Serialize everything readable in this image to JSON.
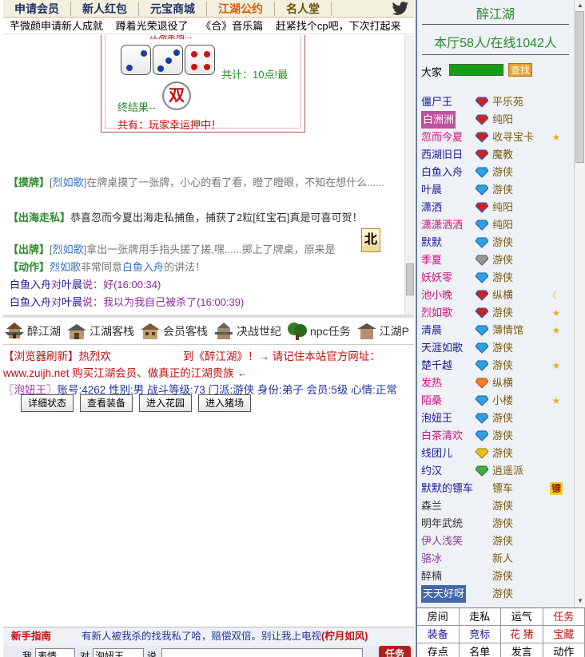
{
  "nav": {
    "items": [
      "申请会员",
      "新人红包",
      "元宝商城",
      "江湖公约",
      "名人堂"
    ],
    "bird_icon": "twitter-bird-icon"
  },
  "ticker": [
    "芊微颜申请新人成就",
    "蹲着光荣退役了",
    "《合》音乐篇",
    "赶紧找个cp吧，下次打起来"
  ],
  "dice": {
    "top_text": "江湖聚赌...",
    "total": "共计：10点!最",
    "final_label": "终结果--",
    "result": "双",
    "wish": "共有：玩家幸运押中！"
  },
  "chat": {
    "m1": {
      "tag": "【摸牌】",
      "lb": "[",
      "name": "烈如歌",
      "rb": "]",
      "text": "在牌桌摸了一张牌，小心的看了看，瞪了瞪眼，不知在想什么......"
    },
    "m2": {
      "tag": "【出海走私】",
      "text1": "恭喜",
      "name": "忽而今夏",
      "text2": "出海走私捕鱼，捕获了2粒[红宝石]真是可喜可贺！"
    },
    "m3": {
      "tag": "【出牌】",
      "lb": "[",
      "name": "烈如歌",
      "rb": "]",
      "text": "拿出一张牌用手指头搓了搓,嘿......掷上了牌桌，原来是",
      "card": "北"
    },
    "m4": {
      "tag": "【动作】",
      "name": "烈如歌",
      "text1": "非常同意",
      "name2": "白鱼入舟",
      "text2": "的讲法！"
    },
    "m5": {
      "from": "白鱼入舟",
      "to_label": "对",
      "to": "叶晨",
      "say": "说：",
      "text": "好",
      "time": "(16:00:34)"
    },
    "m6": {
      "from": "白鱼入舟",
      "to_label": "对",
      "to": "叶晨",
      "say": "说：",
      "text": "我以为我自己被杀了",
      "time": "(16:00:39)"
    }
  },
  "shortcuts": [
    "醉江湖",
    "江湖客栈",
    "会员客栈",
    "决战世纪",
    "npc任务",
    "江湖P"
  ],
  "system": {
    "line1a": "【浏览器刷新】热烈欢",
    "line1b": "到《醉江湖》！→ 请记住本站官方网址：",
    "line2": "www.zuijh.net 购买江湖会员、做真正的江湖贵族 ←",
    "line3a": "〖泡妞王〗",
    "line3b": "账号:4262 性别:男  战斗等级:73 门派:游侠 身份:弟子 会员:5级 心情:正常",
    "buttons": [
      "详细状态",
      "查看装备",
      "进入花园",
      "进入猪场"
    ]
  },
  "guide": {
    "label": "新手指南",
    "text": "有新人被我杀的找我私了哈，赔偿双倍。别让我上电视",
    "highlight": "(柠月如风)"
  },
  "input": {
    "me_label": "我",
    "mood": "表情",
    "to_label": "对",
    "target": "泡妞王",
    "say_label": "说",
    "task": "任务"
  },
  "room": {
    "name": "醉江湖",
    "stats": "本厅58人/在线1042人",
    "dajia": "大家",
    "find": "查找"
  },
  "users": [
    {
      "name": "僵尸王",
      "color": "#1a1a9a",
      "gem": "multi",
      "sect": "平乐苑",
      "extra": ""
    },
    {
      "name": "白洲洲",
      "color": "#ffffff",
      "bg": "#c050a0",
      "gem": "multi",
      "sect": "纯阳",
      "extra": ""
    },
    {
      "name": "忽而今夏",
      "color": "#d01080",
      "gem": "multi",
      "sect": "收寻宝卡",
      "extra": "star2"
    },
    {
      "name": "西湖旧日",
      "color": "#1a1a9a",
      "gem": "multi",
      "sect": "魔教",
      "extra": ""
    },
    {
      "name": "白鱼入舟",
      "color": "#1a1a9a",
      "gem": "blue",
      "sect": "游侠",
      "extra": ""
    },
    {
      "name": "叶晨",
      "color": "#1a1a9a",
      "gem": "blue",
      "sect": "游侠",
      "extra": ""
    },
    {
      "name": "潇洒",
      "color": "#1a1a9a",
      "gem": "multi",
      "sect": "纯阳",
      "extra": ""
    },
    {
      "name": "潇潇洒洒",
      "color": "#d01080",
      "gem": "blue",
      "sect": "纯阳",
      "extra": ""
    },
    {
      "name": "默默",
      "color": "#1a1a9a",
      "gem": "blue",
      "sect": "游侠",
      "extra": ""
    },
    {
      "name": "季夏",
      "color": "#d01080",
      "gem": "gray",
      "sect": "游侠",
      "extra": ""
    },
    {
      "name": "妖妖零",
      "color": "#d01080",
      "gem": "blue",
      "sect": "游侠",
      "extra": ""
    },
    {
      "name": "池小晚",
      "color": "#d01080",
      "gem": "multi",
      "sect": "纵横",
      "extra": "moon5"
    },
    {
      "name": "烈如歌",
      "color": "#d01080",
      "gem": "multi",
      "sect": "游侠",
      "extra": "star1"
    },
    {
      "name": "清晨",
      "color": "#1a1a9a",
      "gem": "blue",
      "sect": "薄情馆",
      "extra": "star1"
    },
    {
      "name": "天涯如歌",
      "color": "#1a1a9a",
      "gem": "blue",
      "sect": "游侠",
      "extra": ""
    },
    {
      "name": "楚千越",
      "color": "#1a1a9a",
      "gem": "blue",
      "sect": "游侠",
      "extra": "star1"
    },
    {
      "name": "发热",
      "color": "#d01080",
      "gem": "orange",
      "sect": "纵横",
      "extra": ""
    },
    {
      "name": "陌桑",
      "color": "#d01080",
      "gem": "blue",
      "sect": "小楼",
      "extra": "star2"
    },
    {
      "name": "泡妞王",
      "color": "#1a1a9a",
      "gem": "blue",
      "sect": "游侠",
      "extra": ""
    },
    {
      "name": "白茶清欢",
      "color": "#d01080",
      "gem": "blue",
      "sect": "游侠",
      "extra": ""
    },
    {
      "name": "线团儿",
      "color": "#1a1a9a",
      "gem": "yellow",
      "sect": "游侠",
      "extra": ""
    },
    {
      "name": "约汉",
      "color": "#1a1a9a",
      "gem": "green",
      "sect": "逍遥派",
      "extra": ""
    },
    {
      "name": "默默的镖车",
      "color": "#1a1a9a",
      "gem": "",
      "sect": "镖车",
      "extra": "biao"
    },
    {
      "name": "森兰",
      "color": "#333333",
      "gem": "",
      "sect": "游侠",
      "extra": ""
    },
    {
      "name": "明年武统",
      "color": "#333333",
      "gem": "",
      "sect": "游侠",
      "extra": ""
    },
    {
      "name": "伊人浅笑",
      "color": "#8a3aa0",
      "gem": "",
      "sect": "游侠",
      "extra": ""
    },
    {
      "name": "骆冰",
      "color": "#8a3aa0",
      "gem": "",
      "sect": "新人",
      "extra": ""
    },
    {
      "name": "醉楠",
      "color": "#333333",
      "gem": "",
      "sect": "游侠",
      "extra": ""
    },
    {
      "name": "天天好呀",
      "color": "#ffffff",
      "bg": "#4466aa",
      "gem": "",
      "sect": "游侠",
      "extra": ""
    }
  ],
  "grid": [
    {
      "label": "房间",
      "color": "#000000"
    },
    {
      "label": "走私",
      "color": "#000000"
    },
    {
      "label": "运气",
      "color": "#000000"
    },
    {
      "label": "任务",
      "color": "#c01010"
    },
    {
      "label": "装备",
      "color": "#1a1a9a"
    },
    {
      "label": "竞标",
      "color": "#1a1a9a"
    },
    {
      "label": "花 猪",
      "color": "#c01010"
    },
    {
      "label": "宝藏",
      "color": "#c01010"
    },
    {
      "label": "存点",
      "color": "#000000"
    },
    {
      "label": "名单",
      "color": "#000000"
    },
    {
      "label": "发言",
      "color": "#000000"
    },
    {
      "label": "动作",
      "color": "#000000"
    }
  ],
  "colors": {
    "accent_green": "#2a8a2a",
    "accent_red": "#c01010",
    "nav_hot": "#d85a00"
  }
}
